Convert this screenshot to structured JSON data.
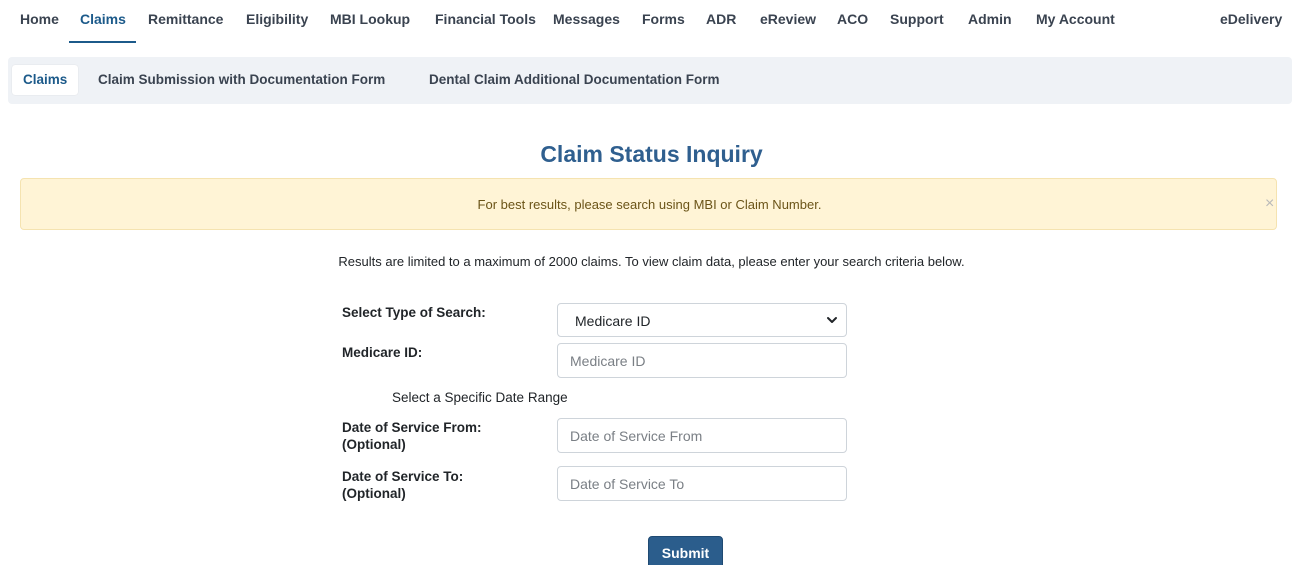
{
  "topnav": {
    "items": [
      "Home",
      "Claims",
      "Remittance",
      "Eligibility",
      "MBI Lookup",
      "Financial Tools",
      "Messages",
      "Forms",
      "ADR",
      "eReview",
      "ACO",
      "Support",
      "Admin",
      "My Account"
    ],
    "active": "Claims",
    "right_item": "eDelivery"
  },
  "subnav": {
    "items": [
      "Claims",
      "Claim Submission with Documentation Form",
      "Dental Claim Additional Documentation Form"
    ],
    "active": "Claims"
  },
  "page": {
    "title": "Claim Status Inquiry",
    "alert_message": "For best results, please search using MBI or Claim Number.",
    "alert_close": "×",
    "limit_text": "Results are limited to a maximum of 2000 claims. To view claim data, please enter your search criteria below."
  },
  "form": {
    "search_type_label": "Select Type of Search:",
    "search_type_value": "Medicare ID",
    "medicare_id_label": "Medicare ID:",
    "medicare_id_placeholder": "Medicare ID",
    "medicare_id_value": "",
    "date_range_heading": "Select a Specific Date Range",
    "dos_from_label": "Date of Service From:",
    "dos_from_optional": "(Optional)",
    "dos_from_placeholder": "Date of Service From",
    "dos_to_label": "Date of Service To:",
    "dos_to_optional": "(Optional)",
    "dos_to_placeholder": "Date of Service To",
    "submit_label": "Submit"
  },
  "colors": {
    "accent": "#1c5a8a",
    "title": "#2f5f8f",
    "alert_bg": "#fff4d6",
    "submit_bg": "#2b5d8c"
  }
}
